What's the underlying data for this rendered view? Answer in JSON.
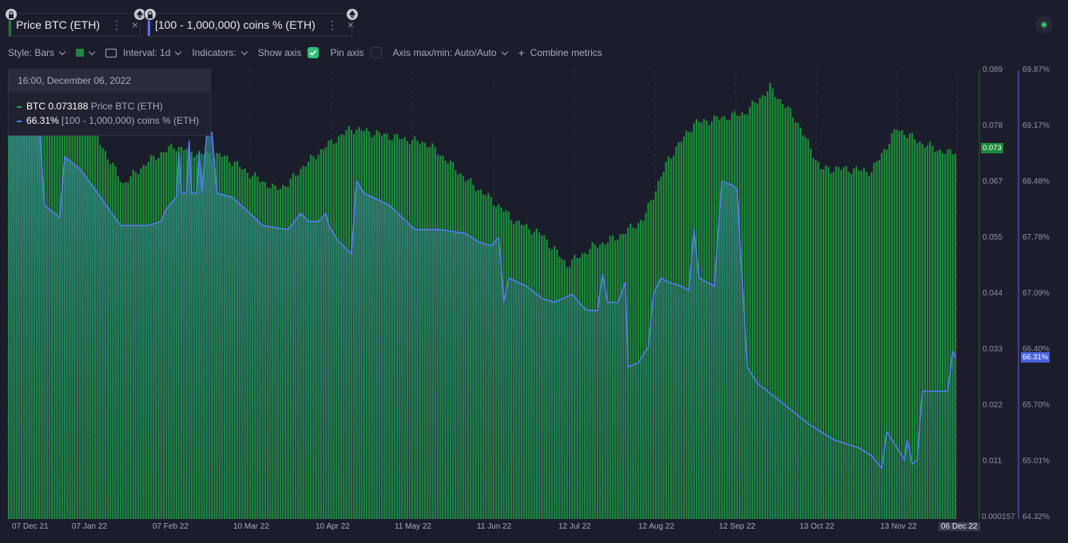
{
  "tabs": [
    {
      "label": "Price BTC (ETH)",
      "menu": "⋮",
      "close": "×",
      "color": "#1a7a35"
    },
    {
      "label": "[100 - 1,000,000) coins % (ETH)",
      "menu": "⋮",
      "close": "×",
      "color": "#5b6cff"
    }
  ],
  "toolbar": {
    "style_label": "Style: Bars",
    "color_swatch": "#1c8a3a",
    "interval_label": "Interval: 1d",
    "indicators_label": "Indicators:",
    "show_axis_label": "Show axis",
    "show_axis_checked": true,
    "pin_axis_label": "Pin axis",
    "pin_axis_checked": false,
    "axis_label": "Axis max/min: Auto/Auto",
    "combine_label": "Combine metrics"
  },
  "tooltip": {
    "date": "16:00, December 06, 2022",
    "rows": [
      {
        "value": "BTC 0.073188",
        "name": "Price BTC (ETH)",
        "color": "#2aa84a"
      },
      {
        "value": "66.31%",
        "name": "[100 - 1,000,000) coins % (ETH)",
        "color": "#5b7bff"
      }
    ]
  },
  "current": {
    "btc": "0.073",
    "pct": "66.31%"
  },
  "chart_data": {
    "type": "bar",
    "x_ticks": [
      "07 Dec 21",
      "07 Jan 22",
      "07 Feb 22",
      "10 Mar 22",
      "10 Apr 22",
      "11 May 22",
      "11 Jun 22",
      "12 Jul 22",
      "12 Aug 22",
      "12 Sep 22",
      "13 Oct 22",
      "13 Nov 22",
      "06 Dec 22"
    ],
    "y_left": {
      "ticks": [
        "0.089",
        "0.078",
        "0.067",
        "0.055",
        "0.044",
        "0.033",
        "0.022",
        "0.011",
        "0.000157"
      ],
      "range": [
        0.000157,
        0.089
      ]
    },
    "y_right": {
      "ticks": [
        "69.87%",
        "69.17%",
        "68.48%",
        "67.78%",
        "67.09%",
        "66.40%",
        "65.70%",
        "65.01%",
        "64.32%"
      ],
      "range": [
        64.32,
        69.87
      ]
    },
    "series": [
      {
        "name": "Price BTC (ETH)",
        "type": "bar",
        "color": "#1c8a3a",
        "keypoints": [
          [
            0,
            0.0835
          ],
          [
            10,
            0.0795
          ],
          [
            25,
            0.0805
          ],
          [
            35,
            0.0755
          ],
          [
            45,
            0.0665
          ],
          [
            55,
            0.071
          ],
          [
            65,
            0.074
          ],
          [
            75,
            0.0725
          ],
          [
            85,
            0.072
          ],
          [
            95,
            0.0685
          ],
          [
            105,
            0.0655
          ],
          [
            110,
            0.0665
          ],
          [
            115,
            0.0695
          ],
          [
            125,
            0.074
          ],
          [
            135,
            0.0775
          ],
          [
            145,
            0.0765
          ],
          [
            155,
            0.0755
          ],
          [
            165,
            0.0745
          ],
          [
            172,
            0.0715
          ],
          [
            180,
            0.0675
          ],
          [
            190,
            0.0635
          ],
          [
            200,
            0.059
          ],
          [
            210,
            0.0565
          ],
          [
            220,
            0.0505
          ],
          [
            230,
            0.054
          ],
          [
            240,
            0.056
          ],
          [
            250,
            0.0595
          ],
          [
            260,
            0.0715
          ],
          [
            270,
            0.0785
          ],
          [
            280,
            0.0795
          ],
          [
            290,
            0.0805
          ],
          [
            300,
            0.0855
          ],
          [
            310,
            0.0795
          ],
          [
            320,
            0.0695
          ],
          [
            330,
            0.0695
          ],
          [
            340,
            0.069
          ],
          [
            350,
            0.0775
          ],
          [
            360,
            0.0745
          ],
          [
            370,
            0.0725
          ],
          [
            375,
            0.0735
          ]
        ]
      },
      {
        "name": "[100 - 1,000,000) coins % (ETH)",
        "type": "line",
        "color": "#5b7bff",
        "keypoints": [
          [
            0,
            69.85
          ],
          [
            12,
            69.2
          ],
          [
            14,
            68.2
          ],
          [
            20,
            68.05
          ],
          [
            22,
            68.8
          ],
          [
            28,
            68.65
          ],
          [
            35,
            68.35
          ],
          [
            44,
            67.95
          ],
          [
            50,
            67.95
          ],
          [
            55,
            67.95
          ],
          [
            60,
            68.0
          ],
          [
            62,
            68.15
          ],
          [
            66,
            68.3
          ],
          [
            67,
            68.85
          ],
          [
            68,
            68.35
          ],
          [
            70,
            68.35
          ],
          [
            71,
            69.0
          ],
          [
            72,
            68.35
          ],
          [
            74,
            68.35
          ],
          [
            75,
            68.85
          ],
          [
            76,
            68.35
          ],
          [
            78,
            69.1
          ],
          [
            80,
            69.1
          ],
          [
            82,
            68.35
          ],
          [
            88,
            68.3
          ],
          [
            95,
            68.1
          ],
          [
            100,
            67.95
          ],
          [
            110,
            67.9
          ],
          [
            115,
            68.1
          ],
          [
            118,
            68.0
          ],
          [
            122,
            68.0
          ],
          [
            125,
            68.1
          ],
          [
            126,
            67.95
          ],
          [
            130,
            67.75
          ],
          [
            135,
            67.6
          ],
          [
            137,
            68.5
          ],
          [
            140,
            68.35
          ],
          [
            150,
            68.2
          ],
          [
            160,
            67.9
          ],
          [
            170,
            67.9
          ],
          [
            180,
            67.85
          ],
          [
            185,
            67.75
          ],
          [
            190,
            67.7
          ],
          [
            193,
            67.8
          ],
          [
            194,
            67.45
          ],
          [
            195,
            67.0
          ],
          [
            197,
            67.3
          ],
          [
            204,
            67.2
          ],
          [
            210,
            67.05
          ],
          [
            215,
            67.0
          ],
          [
            222,
            67.1
          ],
          [
            226,
            66.95
          ],
          [
            228,
            66.9
          ],
          [
            232,
            66.9
          ],
          [
            234,
            67.35
          ],
          [
            236,
            67.0
          ],
          [
            240,
            67.0
          ],
          [
            243,
            67.25
          ],
          [
            244,
            66.2
          ],
          [
            248,
            66.25
          ],
          [
            252,
            66.45
          ],
          [
            254,
            67.1
          ],
          [
            257,
            67.3
          ],
          [
            260,
            67.25
          ],
          [
            265,
            67.2
          ],
          [
            268,
            67.15
          ],
          [
            270,
            67.9
          ],
          [
            272,
            67.3
          ],
          [
            278,
            67.2
          ],
          [
            281,
            68.5
          ],
          [
            285,
            68.45
          ],
          [
            287,
            68.4
          ],
          [
            288,
            67.8
          ],
          [
            291,
            66.2
          ],
          [
            295,
            66.0
          ],
          [
            305,
            65.75
          ],
          [
            315,
            65.5
          ],
          [
            325,
            65.3
          ],
          [
            335,
            65.2
          ],
          [
            340,
            65.1
          ],
          [
            344,
            64.95
          ],
          [
            346,
            65.4
          ],
          [
            350,
            65.2
          ],
          [
            353,
            65.05
          ],
          [
            354,
            65.3
          ],
          [
            356,
            65.0
          ],
          [
            358,
            65.05
          ],
          [
            359,
            65.5
          ],
          [
            360,
            65.9
          ],
          [
            365,
            65.9
          ],
          [
            370,
            65.9
          ],
          [
            372,
            66.4
          ],
          [
            373,
            66.31
          ]
        ]
      }
    ]
  }
}
